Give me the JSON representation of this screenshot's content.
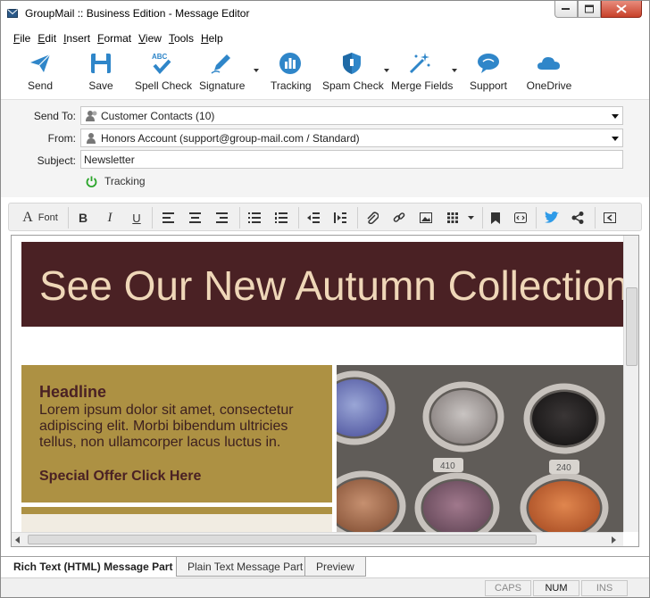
{
  "window": {
    "title": "GroupMail :: Business Edition - Message Editor"
  },
  "menu": [
    "File",
    "Edit",
    "Insert",
    "Format",
    "View",
    "Tools",
    "Help"
  ],
  "toolbar": {
    "send": "Send",
    "save": "Save",
    "spell_check": "Spell Check",
    "signature": "Signature",
    "tracking": "Tracking",
    "spam_check": "Spam Check",
    "merge_fields": "Merge Fields",
    "support": "Support",
    "onedrive": "OneDrive"
  },
  "fields": {
    "send_to_label": "Send To:",
    "send_to_value": "Customer Contacts (10)",
    "from_label": "From:",
    "from_value": "Honors Account  (support@group-mail.com / Standard)",
    "subject_label": "Subject:",
    "subject_value": "Newsletter",
    "tracking_label": "Tracking"
  },
  "format_toolbar": {
    "font_label": "Font"
  },
  "content": {
    "banner": "See Our New Autumn Collection",
    "headline": "Headline",
    "body": "Lorem ipsum dolor sit amet, consectetur adipiscing elit. Morbi bibendum ultricies tellus, non ullamcorper lacus luctus in.",
    "offer": "Special Offer Click Here",
    "photo_tags": [
      "410",
      "240"
    ]
  },
  "colors": {
    "banner_bg": "#4a2124",
    "banner_text": "#efd7b8",
    "promo_bg": "#ad9143",
    "accent_blue": "#2f86c9"
  },
  "tabs": {
    "rich_text": "Rich Text (HTML) Message Part",
    "plain_text": "Plain Text Message Part",
    "preview": "Preview"
  },
  "status": {
    "caps": "CAPS",
    "num": "NUM",
    "ins": "INS"
  }
}
